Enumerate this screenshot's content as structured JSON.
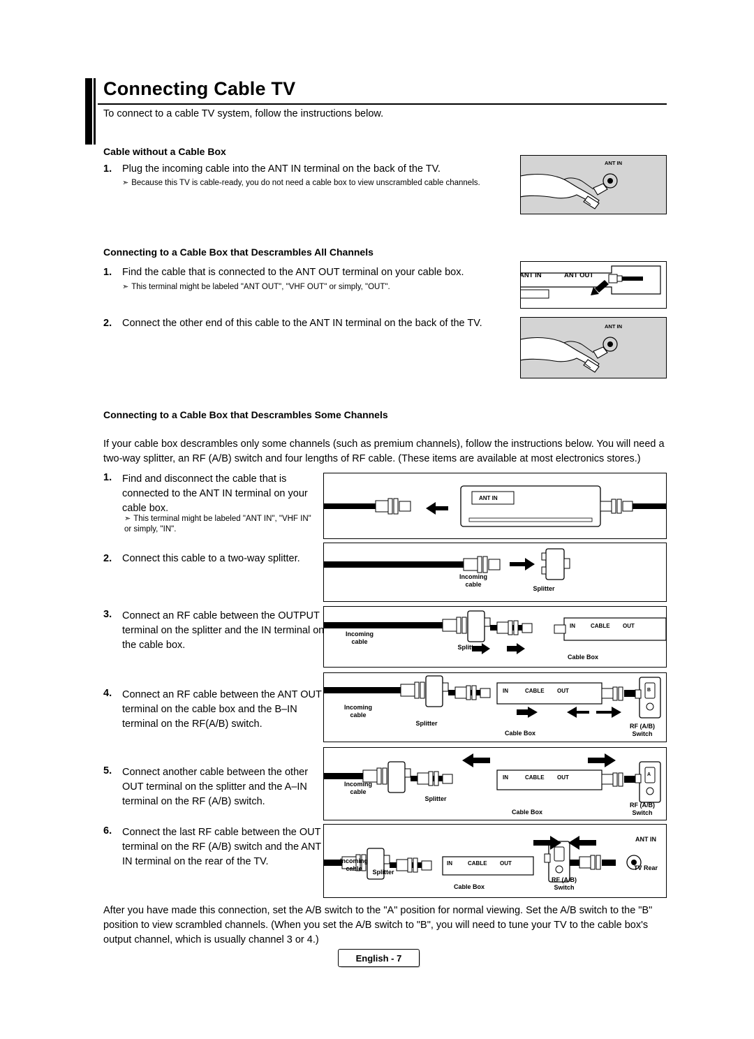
{
  "page": {
    "title": "Connecting Cable TV",
    "intro": "To connect to a cable TV system, follow the instructions below.",
    "footer": "English - 7"
  },
  "sections": [
    {
      "heading": "Cable without a Cable Box",
      "steps": [
        {
          "num": "1.",
          "text": "Plug the incoming cable into the ANT IN terminal on the back of the TV.",
          "note": "Because this TV is cable-ready, you do not need a cable box to view unscrambled cable channels."
        }
      ]
    },
    {
      "heading": "Connecting to a Cable Box that Descrambles All Channels",
      "steps": [
        {
          "num": "1.",
          "text": "Find the cable that is connected to the ANT OUT terminal on your cable box.",
          "note": "This terminal might be labeled \"ANT OUT\", \"VHF OUT\" or simply, \"OUT\"."
        },
        {
          "num": "2.",
          "text": "Connect the other end of this cable to the ANT IN terminal on the back of the TV.",
          "note": ""
        }
      ]
    },
    {
      "heading": "Connecting to a Cable Box that Descrambles Some Channels",
      "paragraph": "If your cable box descrambles only some channels (such as premium channels), follow the instructions below. You will need a two-way splitter, an RF (A/B) switch and four lengths of RF cable. (These items are available at most electronics stores.)",
      "steps": [
        {
          "num": "1.",
          "text": "Find and disconnect the cable that is connected to the ANT IN terminal on your cable box.",
          "note": "This terminal might be labeled \"ANT IN\", \"VHF IN\" or simply, \"IN\"."
        },
        {
          "num": "2.",
          "text": "Connect this cable to a two-way splitter.",
          "note": ""
        },
        {
          "num": "3.",
          "text": "Connect an RF cable between the OUTPUT terminal on the splitter and the IN terminal on the cable box.",
          "note": ""
        },
        {
          "num": "4.",
          "text": "Connect an RF cable between the ANT OUT terminal on the cable box and the B–IN terminal on the RF(A/B) switch.",
          "note": ""
        },
        {
          "num": "5.",
          "text": "Connect another cable between the other OUT terminal on the splitter and the A–IN terminal on the RF (A/B) switch.",
          "note": ""
        },
        {
          "num": "6.",
          "text": "Connect the last RF cable between the OUT terminal on the RF (A/B) switch and the ANT IN terminal on the rear of the TV.",
          "note": ""
        }
      ]
    }
  ],
  "closing": "After you have made this connection, set the A/B switch to the \"A\" position for normal viewing. Set the A/B switch to the \"B\" position to view scrambled channels. (When you set the A/B switch to \"B\", you will need to tune your TV to the cable box's output channel, which is usually channel 3 or 4.)",
  "figures": {
    "fig1": {
      "label": "ANT IN"
    },
    "fig2": {
      "label_in": "ANT IN",
      "label_out": "ANT OUT"
    },
    "fig3": {
      "label": "ANT IN"
    },
    "fig4": {
      "label": "ANT IN"
    },
    "fig5": {
      "incoming": "Incoming\ncable",
      "splitter": "Splitter"
    },
    "fig6": {
      "incoming_line1": "Incoming",
      "incoming_line2": "cable",
      "splitter": "Splitter",
      "cablebox": "Cable Box",
      "box_in": "IN",
      "box_cable": "CABLE",
      "box_out": "OUT"
    },
    "fig7": {
      "incoming_line1": "Incoming",
      "incoming_line2": "cable",
      "splitter": "Splitter",
      "cablebox": "Cable Box",
      "box_in": "IN",
      "box_cable": "CABLE",
      "box_out": "OUT",
      "switch_line1": "RF (A/B)",
      "switch_line2": "Switch",
      "switch_b": "B"
    },
    "fig8": {
      "incoming_line1": "Incoming",
      "incoming_line2": "cable",
      "splitter": "Splitter",
      "cablebox": "Cable Box",
      "box_in": "IN",
      "box_cable": "CABLE",
      "box_out": "OUT",
      "switch_line1": "RF (A/B)",
      "switch_line2": "Switch",
      "switch_a": "A"
    },
    "fig9": {
      "incoming_line1": "Incoming",
      "incoming_line2": "cable",
      "splitter": "Splitter",
      "cablebox": "Cable Box",
      "box_in": "IN",
      "box_cable": "CABLE",
      "box_out": "OUT",
      "switch_line1": "RF (A/B)",
      "switch_line2": "Switch",
      "ant_in": "ANT IN",
      "tv_rear": "TV Rear"
    }
  }
}
